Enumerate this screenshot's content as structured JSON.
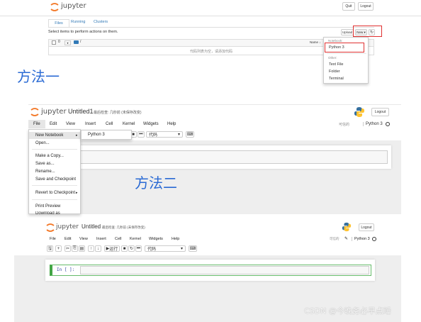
{
  "section1": {
    "logo": "jupyter",
    "quit": "Quit",
    "logout": "Logout",
    "tabs": [
      "Files",
      "Running",
      "Clusters"
    ],
    "select_hint": "Select items to perform actions on them.",
    "upload": "Upload",
    "new": "New ▾",
    "refresh_icon": "↻",
    "checkbox_count": "0",
    "path": "/",
    "name_header": "Name ↓",
    "empty_msg": "代码列表为空，请添加代码",
    "dropdown": {
      "notebook_header": "Notebook:",
      "python3": "Python 3",
      "other_header": "Other:",
      "text_file": "Text File",
      "folder": "Folder",
      "terminal": "Terminal"
    }
  },
  "label1": "方法一",
  "label2": "方法二",
  "section2": {
    "logo": "jupyter",
    "title": "Untitled1",
    "checkpoint": "最后检查: 几秒前 (未保存改变)",
    "logout": "Logout",
    "menu": [
      "File",
      "Edit",
      "View",
      "Insert",
      "Cell",
      "Kernel",
      "Widgets",
      "Help"
    ],
    "trusted": "可信的",
    "kernel": "Python 3",
    "cell_type": "代码",
    "file_menu": [
      "New Notebook",
      "Open...",
      "Make a Copy...",
      "Save as...",
      "Rename...",
      "Save and Checkpoint",
      "Revert to Checkpoint",
      "Print Preview",
      "Download as"
    ],
    "submenu": "Python 3"
  },
  "section3": {
    "logo": "jupyter",
    "title": "Untitled",
    "checkpoint": "最后检查: 几秒前 (未保存改变)",
    "logout": "Logout",
    "menu": [
      "File",
      "Edit",
      "View",
      "Insert",
      "Cell",
      "Kernel",
      "Widgets",
      "Help"
    ],
    "trusted": "可信的",
    "kernel": "Python 3",
    "run": "运行",
    "cell_type": "代码",
    "prompt": "In [ ]:"
  },
  "watermark": "CSDN @今晚务必早点睡",
  "colors": {
    "accent_blue": "#2a6ad4",
    "highlight_red": "#e03030",
    "jupyter_orange": "#f37726"
  }
}
